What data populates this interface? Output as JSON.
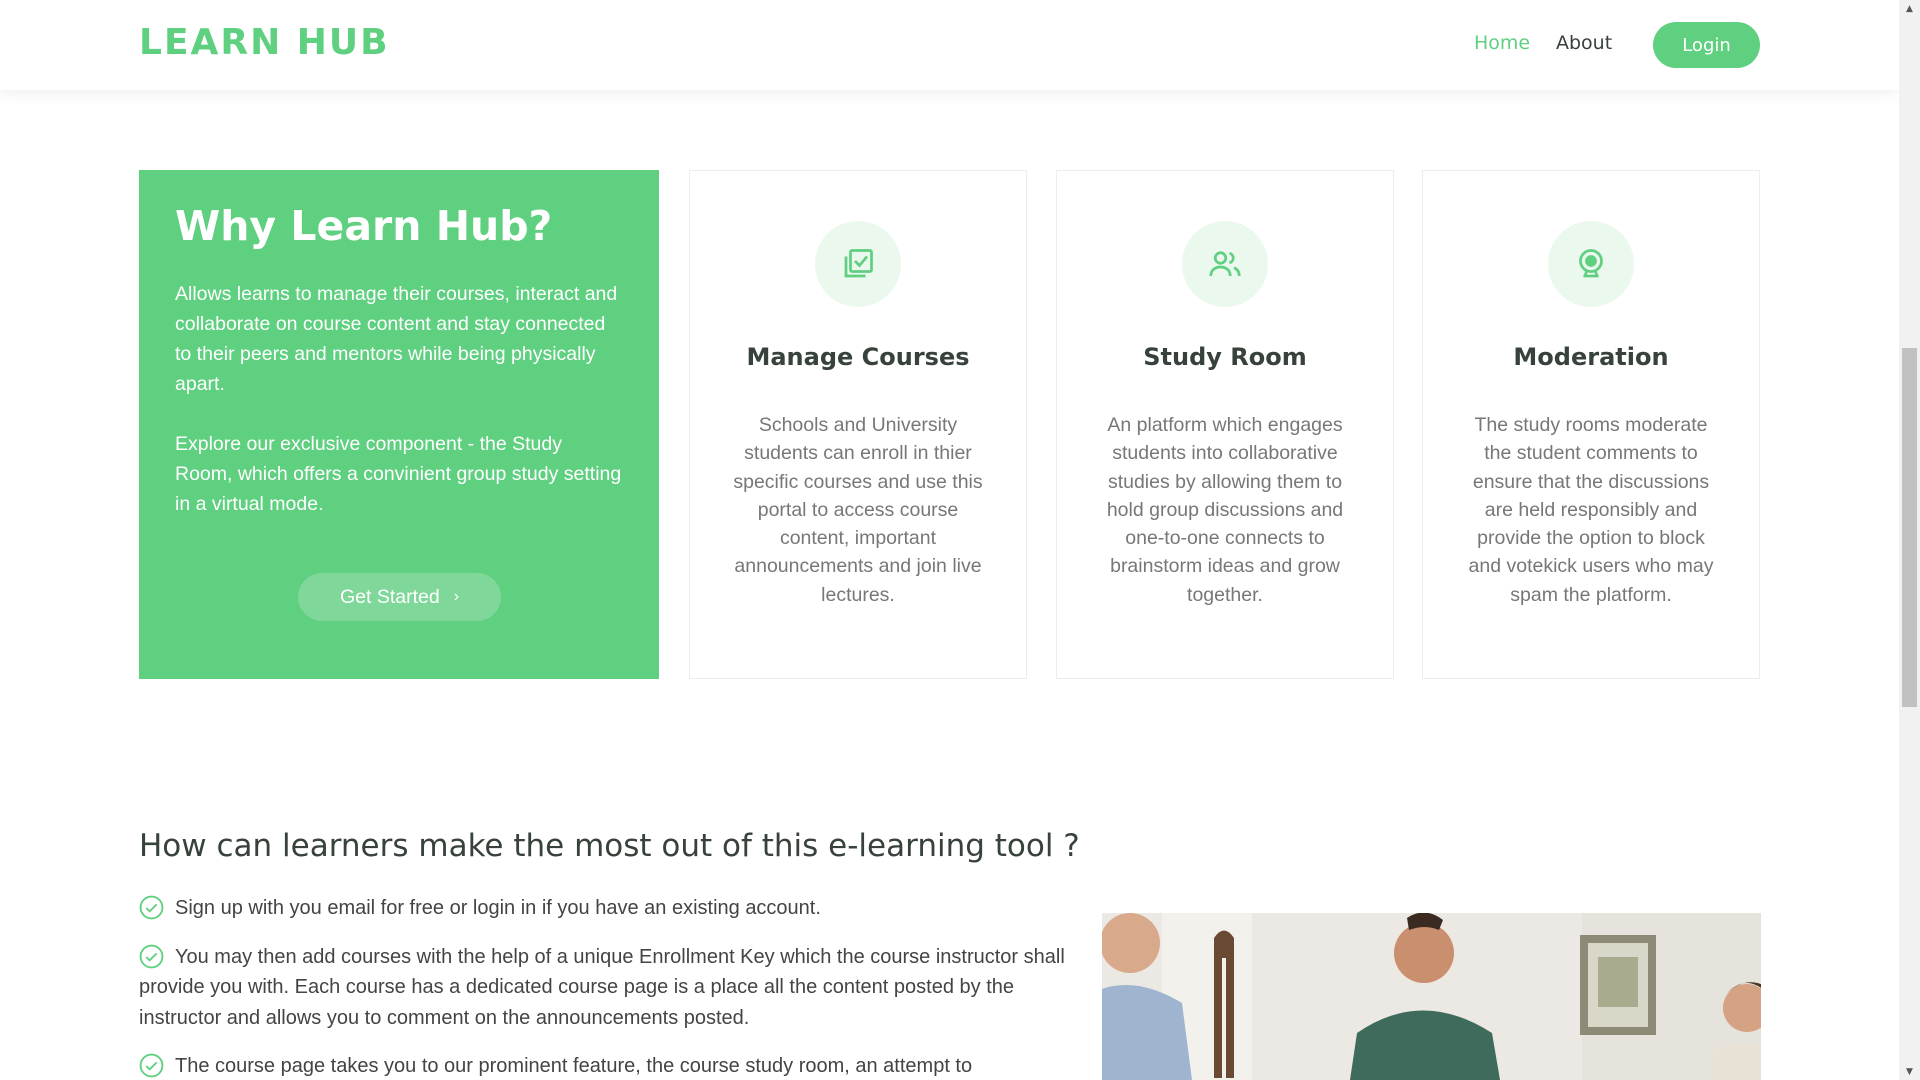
{
  "brand": {
    "logo": "LEARN HUB",
    "accent": "#5fcf80"
  },
  "nav": {
    "home": "Home",
    "about": "About",
    "login": "Login"
  },
  "why": {
    "title": "Why Learn Hub?",
    "paragraph1": "Allows learns to manage their courses, interact and collaborate on course content and stay connected to their peers and mentors while being physically apart.",
    "paragraph2": "Explore our exclusive component - the Study Room, which offers a convinient group study setting in a virtual mode.",
    "cta": "Get Started",
    "cta_icon": "chevron-right-icon"
  },
  "features": [
    {
      "icon": "course-check-icon",
      "title": "Manage Courses",
      "text": "Schools and University students can enroll in thier specific courses and use this portal to access course content, important announcements and join live lectures."
    },
    {
      "icon": "people-icon",
      "title": "Study Room",
      "text": "An platform which engages students into collaborative studies by allowing them to hold group discussions and one-to-one connects to brainstorm ideas and grow together."
    },
    {
      "icon": "webcam-icon",
      "title": "Moderation",
      "text": "The study rooms moderate the student comments to ensure that the discussions are held responsibly and provide the option to block and votekick users who may spam the platform."
    }
  ],
  "how": {
    "title": "How can learners make the most out of this e-learning tool ?",
    "steps": [
      "Sign up with you email for free or login in if you have an existing account.",
      "You may then add courses with the help of a unique Enrollment Key which the course instructor shall provide you with. Each course has a dedicated course page is a place all the content posted by the instructor and allows you to comment on the announcements posted.",
      "The course page takes you to our prominent feature, the course study room, an attempt to"
    ]
  }
}
